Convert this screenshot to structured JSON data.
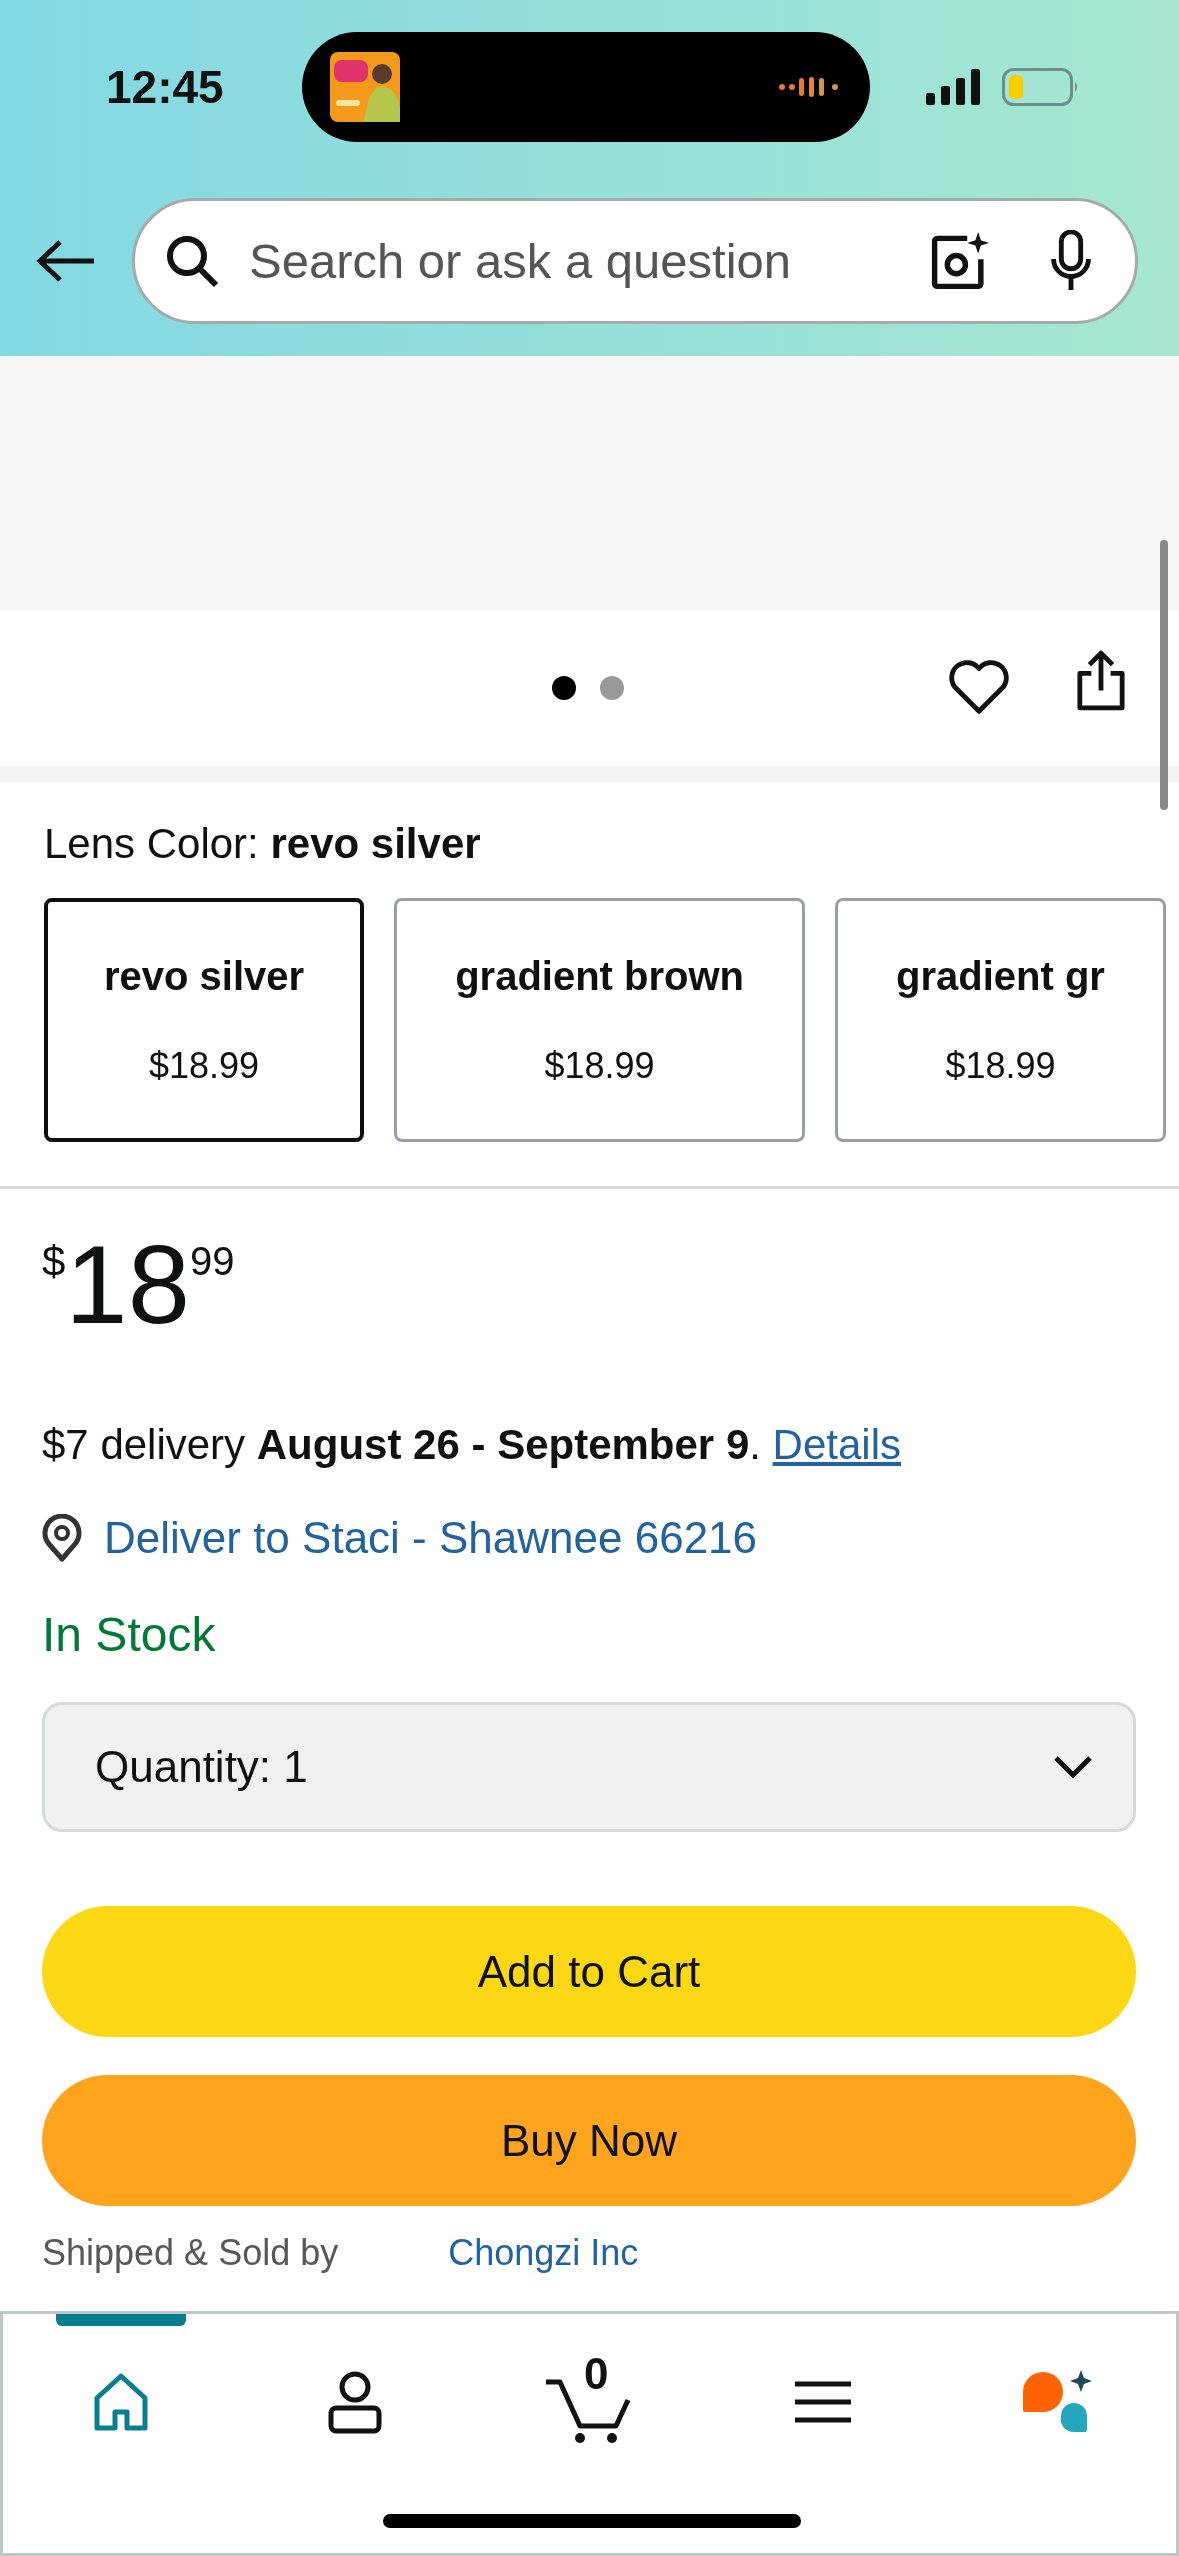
{
  "status_bar": {
    "time": "12:45"
  },
  "search": {
    "placeholder": "Search or ask a question"
  },
  "image_pager": {
    "pages": [
      {
        "selected": true
      },
      {
        "selected": false
      }
    ]
  },
  "lens_color": {
    "label": "Lens Color:",
    "value": "revo silver",
    "options": [
      {
        "name": "revo silver",
        "price": "$18.99",
        "selected": true
      },
      {
        "name": "gradient brown",
        "price": "$18.99",
        "selected": false
      },
      {
        "name": "gradient gr",
        "price": "$18.99",
        "selected": false
      }
    ]
  },
  "price": {
    "currency": "$",
    "whole": "18",
    "fraction": "99"
  },
  "delivery": {
    "text": "$7 delivery **August 26 - September 9**.",
    "link": "Details"
  },
  "location": "Deliver to Staci - Shawnee 66216",
  "stock": "In Stock",
  "quantity": {
    "label": "Quantity:",
    "value": "1"
  },
  "buttons": [
    {
      "label": "Add to Cart",
      "kind": "cart"
    },
    {
      "label": "Buy Now",
      "kind": "buy"
    }
  ],
  "seller": {
    "label": "Shipped & Sold by",
    "value": "Chongzi Inc"
  },
  "tab_bar": {
    "items": [
      {
        "kind": "home",
        "selected": true
      },
      {
        "kind": "account",
        "selected": false
      },
      {
        "kind": "cart",
        "badge": "0",
        "selected": false
      },
      {
        "kind": "menu",
        "selected": false
      },
      {
        "kind": "assistant",
        "selected": false
      }
    ]
  }
}
